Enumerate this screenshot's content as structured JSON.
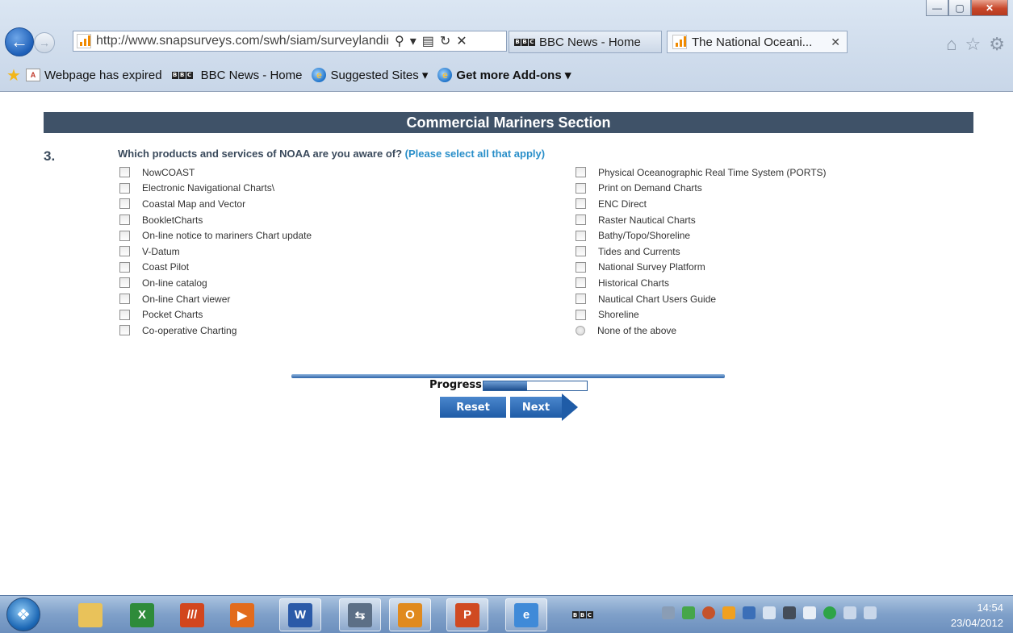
{
  "browser": {
    "address": "http://www.snapsurveys.com/swh/siam/surveylanding/inte",
    "tabs": [
      {
        "label": "BBC News - Home"
      },
      {
        "label": "The National Oceani..."
      }
    ],
    "favorites": {
      "item1": "Webpage has expired",
      "item2": "BBC News - Home",
      "item3": "Suggested Sites ▾",
      "item4": "Get more Add-ons ▾"
    },
    "bbc_letters": [
      "B",
      "B",
      "C"
    ]
  },
  "survey": {
    "section_title": "Commercial Mariners Section",
    "question_number": "3.",
    "question_text": "Which products and services of NOAA are you aware of?",
    "question_hint": "(Please select all that apply)",
    "left_options": [
      "NowCOAST",
      "Electronic Navigational Charts\\",
      "Coastal Map and Vector",
      "BookletCharts",
      "On-line notice to mariners Chart update",
      "V-Datum",
      "Coast Pilot",
      "On-line catalog",
      "On-line Chart viewer",
      "Pocket Charts",
      "Co-operative Charting"
    ],
    "right_options": [
      "Physical Oceanographic Real Time System (PORTS)",
      "Print on Demand Charts",
      "ENC Direct",
      "Raster Nautical Charts",
      "Bathy/Topo/Shoreline",
      "Tides and Currents",
      "National Survey Platform",
      "Historical Charts",
      "Nautical Chart Users Guide",
      "Shoreline",
      "None of the above"
    ],
    "progress_label": "Progress",
    "progress_fraction": 0.42,
    "reset_label": "Reset",
    "next_label": "Next"
  },
  "taskbar": {
    "apps": [
      "explorer-icon",
      "excel-icon",
      "pen-app-icon",
      "media-icon",
      "word-icon",
      "sync-icon",
      "outlook-icon",
      "powerpoint-icon",
      "internet-explorer-icon"
    ],
    "clock_time": "14:54",
    "clock_date": "23/04/2012"
  },
  "colors": {
    "section_bar": "#3f5268",
    "hint_text": "#2a8fc9",
    "button_blue": "#1f5ca7"
  }
}
